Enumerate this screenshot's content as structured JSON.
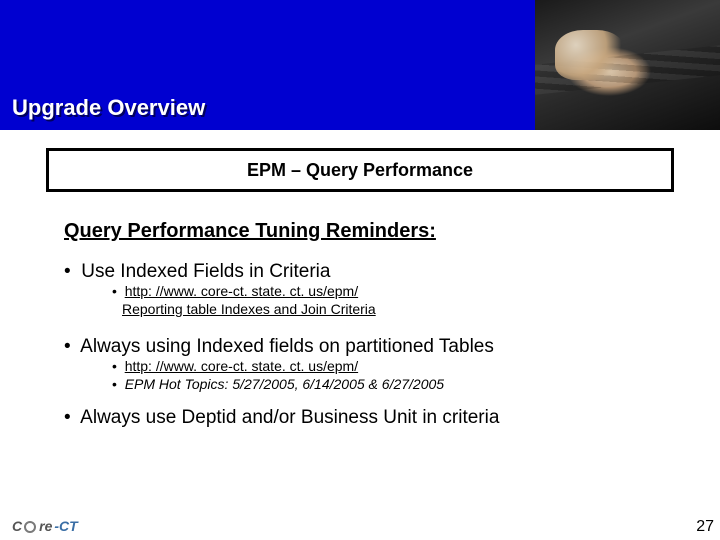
{
  "slide": {
    "title": "Upgrade Overview",
    "section_bar": "EPM – Query Performance",
    "subhead": "Query Performance Tuning Reminders:",
    "bullets": [
      {
        "text": "Use Indexed Fields in Criteria",
        "sub": [
          {
            "text": "http: //www. core-ct. state. ct. us/epm/",
            "underline": true
          },
          {
            "text": "Reporting table Indexes and Join Criteria",
            "underline": true,
            "continuation": true
          }
        ]
      },
      {
        "text": "Always using Indexed fields on partitioned Tables",
        "sub": [
          {
            "text": "http: //www. core-ct. state. ct. us/epm/",
            "underline": true
          },
          {
            "text": "EPM Hot Topics:  5/27/2005, 6/14/2005 & 6/27/2005",
            "italic": true
          }
        ]
      },
      {
        "text": "Always use Deptid and/or Business Unit in criteria",
        "sub": []
      }
    ],
    "footer_logo": "Core-CT",
    "footer_logo_parts": {
      "prefix": "C",
      "mid": "re",
      "suffix": "-CT"
    },
    "page_num": "27"
  }
}
